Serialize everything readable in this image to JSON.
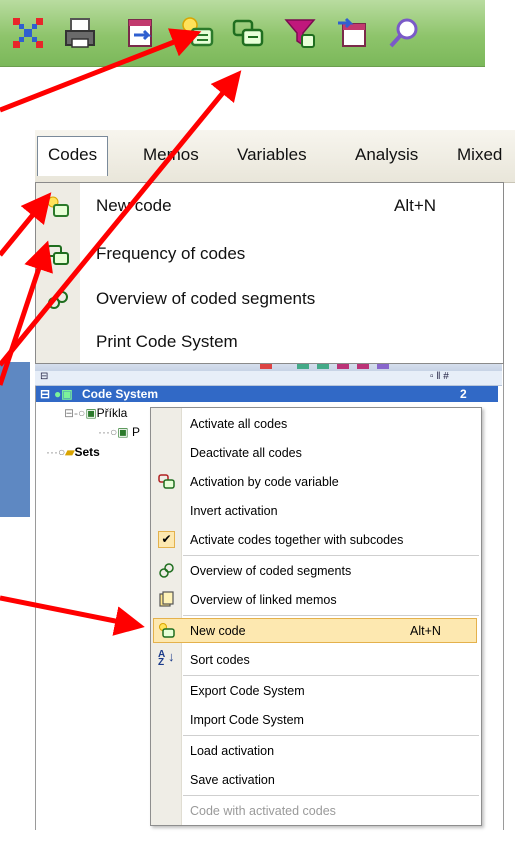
{
  "toolbar": {
    "icons": [
      "activate-codes-icon",
      "print-icon",
      "import-icon",
      "new-code-icon",
      "code-frequency-icon",
      "filter-icon",
      "export-icon",
      "search-icon"
    ]
  },
  "menubar": {
    "items": [
      {
        "label": "Codes",
        "active": true
      },
      {
        "label": "Memos"
      },
      {
        "label": "Variables"
      },
      {
        "label": "Analysis"
      },
      {
        "label": "Mixed"
      }
    ]
  },
  "codes_menu": {
    "items": [
      {
        "label": "New code",
        "shortcut": "Alt+N",
        "icon": "new-code-icon"
      },
      {
        "label": "Frequency of codes",
        "shortcut": "",
        "icon": "code-frequency-icon"
      },
      {
        "label": "Overview of coded segments",
        "shortcut": "",
        "icon": "coded-segments-icon"
      },
      {
        "label": "Print Code System",
        "shortcut": "",
        "icon": ""
      }
    ]
  },
  "tree": {
    "selected_label": "Code System",
    "selected_count": "2",
    "child_label": "Příkla",
    "grandchild_label": "P",
    "sets_label": "Sets"
  },
  "context_menu": {
    "items": [
      {
        "label": "Activate all codes",
        "icon": ""
      },
      {
        "label": "Deactivate all codes",
        "icon": ""
      },
      {
        "label": "Activation by code variable",
        "icon": "code-variable-icon"
      },
      {
        "label": "Invert activation",
        "icon": ""
      },
      {
        "label": "Activate codes together with subcodes",
        "icon": "check-icon"
      },
      {
        "label": "Overview of coded segments",
        "icon": "coded-segments-icon"
      },
      {
        "label": "Overview of linked memos",
        "icon": "memo-icon"
      },
      {
        "label": "New code",
        "shortcut": "Alt+N",
        "icon": "new-code-icon"
      },
      {
        "label": "Sort codes",
        "icon": "sort-az-icon"
      },
      {
        "label": "Export Code System",
        "icon": ""
      },
      {
        "label": "Import Code System",
        "icon": ""
      },
      {
        "label": "Load activation",
        "icon": ""
      },
      {
        "label": "Save activation",
        "icon": ""
      },
      {
        "label": "Code with activated codes",
        "icon": ""
      }
    ]
  },
  "colors": {
    "arrow": "#ff0000",
    "toolbar_green": "#8ec46b",
    "selection_blue": "#3169c6",
    "highlight": "#fde8b0"
  }
}
